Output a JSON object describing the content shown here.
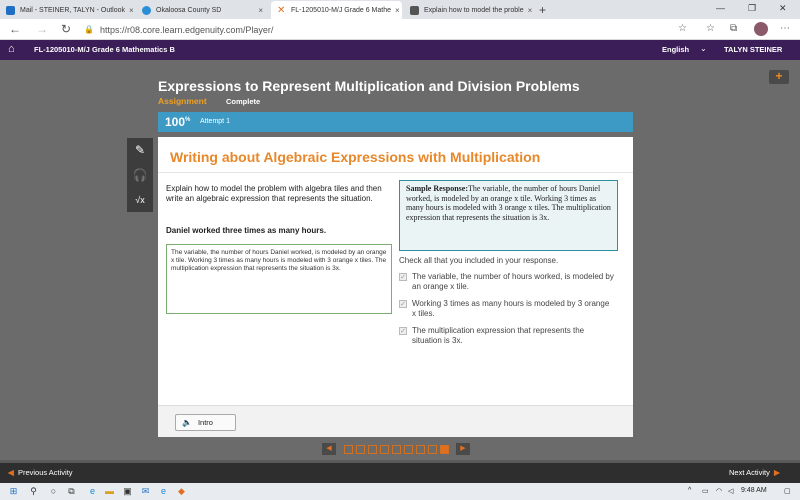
{
  "browser": {
    "tabs": [
      {
        "label": "Mail - STEINER, TALYN - Outlook",
        "close": "×"
      },
      {
        "label": "Okaloosa County SD",
        "close": "×"
      },
      {
        "label": "FL-1205010-M/J Grade 6 Mathe",
        "close": "×"
      },
      {
        "label": "Explain how to model the proble",
        "close": "×"
      }
    ],
    "new_tab": "+",
    "url": "https://r08.core.learn.edgenuity.com/Player/"
  },
  "site": {
    "course_title": "FL-1205010-M/J Grade 6 Mathematics B",
    "language": "English",
    "user": "TALYN STEINER"
  },
  "lesson": {
    "title": "Expressions to Represent Multiplication and Division Problems",
    "type": "Assignment",
    "status": "Complete",
    "progress_pct": "100",
    "progress_suffix": "%",
    "attempt": "Attempt 1"
  },
  "activity": {
    "title": "Writing about Algebraic Expressions with Multiplication",
    "prompt": "Explain how to model the problem with algebra tiles and then write an algebraic expression that represents the situation.",
    "statement": "Daniel worked three times as many hours.",
    "student_answer": "The variable, the number of hours Daniel worked, is modeled by an orange x tile. Working 3 times as many hours is modeled with 3 orange x tiles. The multiplication expression that represents the situation is 3x.",
    "sample_label": "Sample Response:",
    "sample_text": "The variable, the number of hours Daniel worked, is modeled by an orange x tile. Working 3 times as many hours is modeled with 3 orange x tiles. The multiplication expression that represents the situation is 3x.",
    "check_prompt": "Check all that you included in your response.",
    "checklist": [
      {
        "label": "The variable, the number of hours worked, is modeled by an orange x tile.",
        "checked": true
      },
      {
        "label": "Working 3 times as many hours is modeled by 3 orange x tiles.",
        "checked": true
      },
      {
        "label": "The multiplication expression that represents the situation is 3x.",
        "checked": true
      }
    ],
    "intro_button": "Intro"
  },
  "pager": {
    "total": 9,
    "current": 9
  },
  "nav": {
    "previous": "Previous Activity",
    "next": "Next Activity"
  },
  "taskbar": {
    "time": "9:48 AM"
  },
  "colors": {
    "accent_orange": "#e8882a",
    "header_purple": "#3b1e57",
    "progress_blue": "#3d9ac4",
    "sample_border": "#2f8fa0"
  }
}
